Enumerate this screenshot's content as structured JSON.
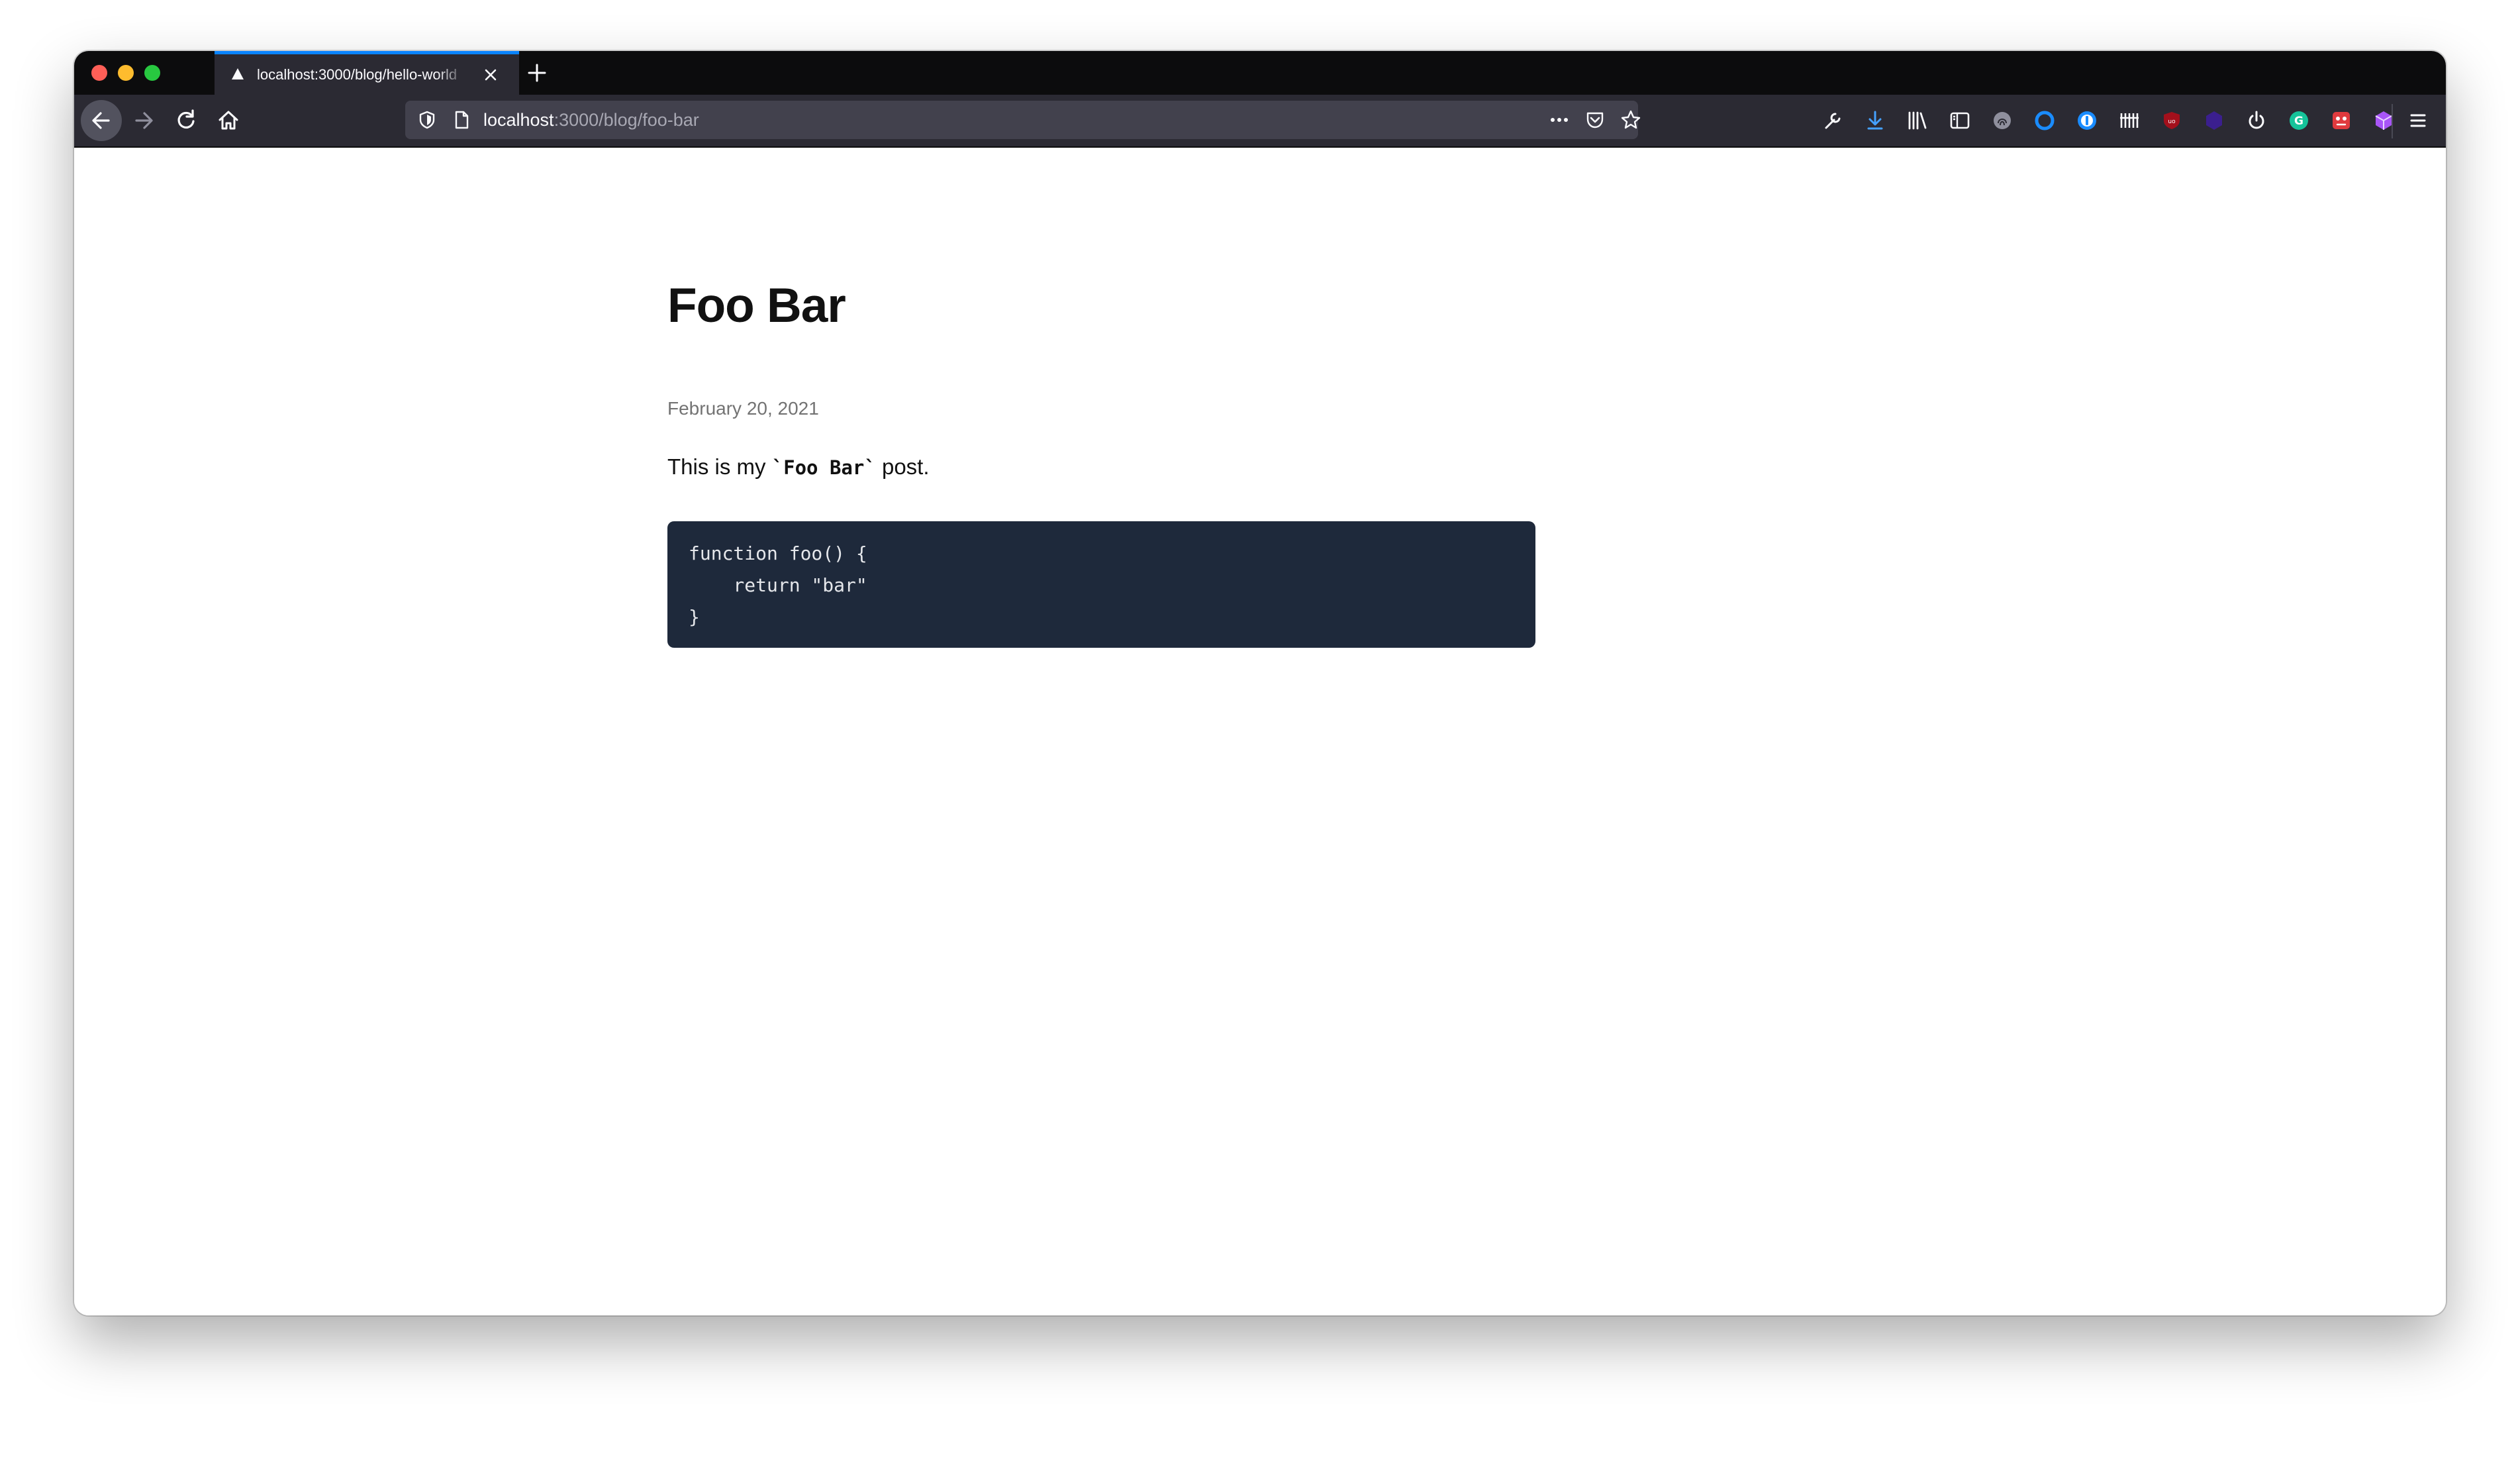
{
  "browser": {
    "tab": {
      "title": "localhost:3000/blog/hello-world"
    },
    "url": {
      "host": "localhost",
      "path": ":3000/blog/foo-bar"
    },
    "icons": {
      "tab": [
        "nextjs-favicon-icon",
        "close-tab-icon",
        "new-tab-icon"
      ],
      "nav": [
        "back-arrow-icon",
        "forward-arrow-icon",
        "reload-icon",
        "home-icon"
      ],
      "urlbar": [
        "tracking-shield-icon",
        "page-info-icon",
        "page-actions-ellipsis-icon",
        "pocket-icon",
        "bookmark-star-icon"
      ],
      "toolbar": [
        "developer-wrench-icon",
        "downloads-icon",
        "library-icon",
        "sidebar-icon",
        "fingerprint-extension-icon",
        "blue-circle-extension-icon",
        "onepassword-icon",
        "toolbar-bars-icon",
        "ublock-origin-icon",
        "dark-purple-extension-icon",
        "power-icon",
        "grammarly-icon",
        "red-extension-icon",
        "purple-cube-extension-icon",
        "hamburger-menu-icon"
      ]
    },
    "colors": {
      "tab_strip": "#0c0c0d",
      "toolbar": "#2b2a33",
      "urlbar": "#42414d",
      "tab_accent": "#0a84ff"
    }
  },
  "post": {
    "title": "Foo Bar",
    "date": "February 20, 2021",
    "intro_before": "This is my ",
    "intro_code": "`Foo Bar`",
    "intro_after": " post.",
    "code_lines": [
      "function foo() {",
      "    return \"bar\"",
      "}"
    ],
    "code_bg": "#1e293b"
  }
}
